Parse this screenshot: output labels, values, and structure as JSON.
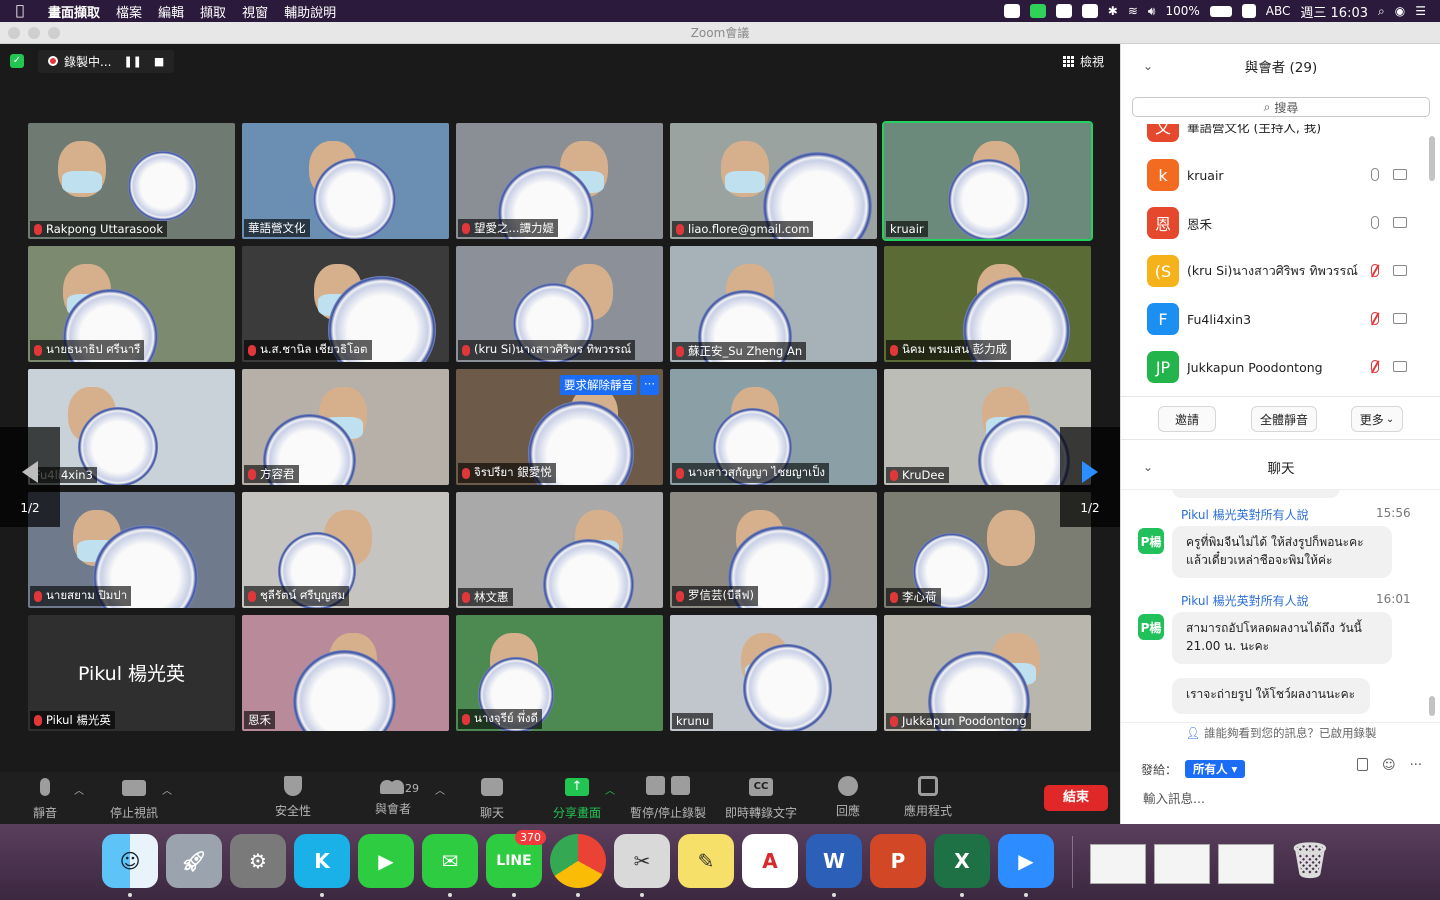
{
  "menubar": {
    "app": "畫面擷取",
    "items": [
      "檔案",
      "編輯",
      "擷取",
      "視窗",
      "輔助說明"
    ],
    "input_method": "ABC",
    "battery": "100%",
    "clock": "週三 16:03"
  },
  "window": {
    "title": "Zoom會議"
  },
  "recording": {
    "label": "錄製中..."
  },
  "view_button": "檢視",
  "tiles": [
    {
      "name": "Rakpong Uttarasook",
      "muted": true,
      "bg": "#6f7a72"
    },
    {
      "name": "華語營文化",
      "muted": false,
      "bg": "#6a8fb3"
    },
    {
      "name": "望愛之...譚力媞",
      "muted": true,
      "bg": "#8a8f96"
    },
    {
      "name": "liao.flore@gmail.com",
      "muted": true,
      "bg": "#9aa3a0"
    },
    {
      "name": "kruair",
      "muted": false,
      "bg": "#6c8a7b",
      "active": true
    },
    {
      "name": "นายธนาธิป ศรีนารี",
      "muted": true,
      "bg": "#7c8a6f"
    },
    {
      "name": "น.ส.ชานิล เชียวธิโอต",
      "muted": true,
      "bg": "#3b3b3b"
    },
    {
      "name": "(kru Si)นางสาวศิริพร ทิพวรรณ์",
      "muted": true,
      "bg": "#8c9098"
    },
    {
      "name": "蘇正安_Su Zheng An",
      "muted": true,
      "bg": "#a7b1b8"
    },
    {
      "name": "นิคม พรมเสน 彭力成",
      "muted": true,
      "bg": "#5a6b36"
    },
    {
      "name": "Fu4li4xin3",
      "muted": false,
      "bg": "#c9d2d8"
    },
    {
      "name": "方容君",
      "muted": true,
      "bg": "#b7b0a8"
    },
    {
      "name": "จิรปรียา 銀愛悦",
      "muted": true,
      "bg": "#6d5a48",
      "unmute_request": "要求解除靜音",
      "more": "···"
    },
    {
      "name": "นางสาวสุกัญญา ไชยญาเป็ง",
      "muted": true,
      "bg": "#8aa0a6"
    },
    {
      "name": "KruDee",
      "muted": true,
      "bg": "#bdbdb8"
    },
    {
      "name": "นายสยาม ปิมปา",
      "muted": true,
      "bg": "#6f7b8c"
    },
    {
      "name": "ชุลีรัตน์ ศรีบุญสม",
      "muted": true,
      "bg": "#c6c4c0"
    },
    {
      "name": "林文惠",
      "muted": true,
      "bg": "#a9a9a9"
    },
    {
      "name": "罗信芸(บีลีฟ)",
      "muted": true,
      "bg": "#8e8a84"
    },
    {
      "name": "李心荷",
      "muted": true,
      "bg": "#7c7d72"
    },
    {
      "name": "Pikul 楊光英",
      "muted": true,
      "bg": "#2f2f2f",
      "display_name": "Pikul 楊光英"
    },
    {
      "name": "恩禾",
      "muted": false,
      "bg": "#b88a9a"
    },
    {
      "name": "นางจุรีย์ พึ่งดี",
      "muted": true,
      "bg": "#4d8a52"
    },
    {
      "name": "krunu",
      "muted": false,
      "bg": "#c1c5cc"
    },
    {
      "name": "Jukkapun Poodontong",
      "muted": true,
      "bg": "#b9b6ad"
    }
  ],
  "pager": {
    "label": "1/2"
  },
  "toolbar": {
    "mute": "靜音",
    "video": "停止視訊",
    "security": "安全性",
    "participants": "與會者",
    "participants_count": "29",
    "chat": "聊天",
    "share": "分享畫面",
    "record": "暫停/停止錄製",
    "captions": "即時轉錄文字",
    "cc_icon": "CC",
    "reactions": "回應",
    "apps": "應用程式",
    "end": "結束"
  },
  "participants_panel": {
    "title": "與會者 (29)",
    "search_placeholder": "搜尋",
    "partial_top": "華語營文化 (主持人, 我)",
    "list": [
      {
        "initial": "k",
        "name": "kruair",
        "color": "#f26b21",
        "mic": "on"
      },
      {
        "initial": "恩",
        "name": "恩禾",
        "color": "#e5482d",
        "mic": "on"
      },
      {
        "initial": "(S",
        "name": "(kru Si)นางสาวศิริพร ทิพวรรณ์",
        "color": "#f6b21b",
        "mic": "off"
      },
      {
        "initial": "F",
        "name": "Fu4li4xin3",
        "color": "#1b8ff2",
        "mic": "off"
      },
      {
        "initial": "JP",
        "name": "Jukkapun Poodontong",
        "color": "#23b44b",
        "mic": "off"
      }
    ],
    "invite": "邀請",
    "mute_all": "全體靜音",
    "more": "更多"
  },
  "chat_panel": {
    "title": "聊天",
    "messages": [
      {
        "sender": "Pikul 楊光英對所有人說",
        "time": "15:56",
        "avatar": "P楊",
        "lines": [
          "ครูที่พิมจีนไม่ได้ ให้ส่งรูปก็พอนะคะ",
          "แล้วเดี๋ยวเหล่าชือจะพิมให้ค่ะ"
        ]
      },
      {
        "sender": "Pikul 楊光英對所有人說",
        "time": "16:01",
        "avatar": "P楊",
        "lines": [
          "สามารถอัปโหลดผลงานได้ถึง วันนี้",
          "21.00 น. นะคะ"
        ]
      },
      {
        "sender": "",
        "time": "",
        "avatar": "",
        "lines": [
          "เราจะถ่ายรูป ให้โชว์ผลงานนะคะ"
        ]
      }
    ],
    "notice": "誰能夠看到您的訊息？已啟用錄製",
    "send_to_label": "發給：",
    "send_to_value": "所有人",
    "input_placeholder": "輸入訊息..."
  },
  "dock": {
    "line_badge": "370"
  }
}
